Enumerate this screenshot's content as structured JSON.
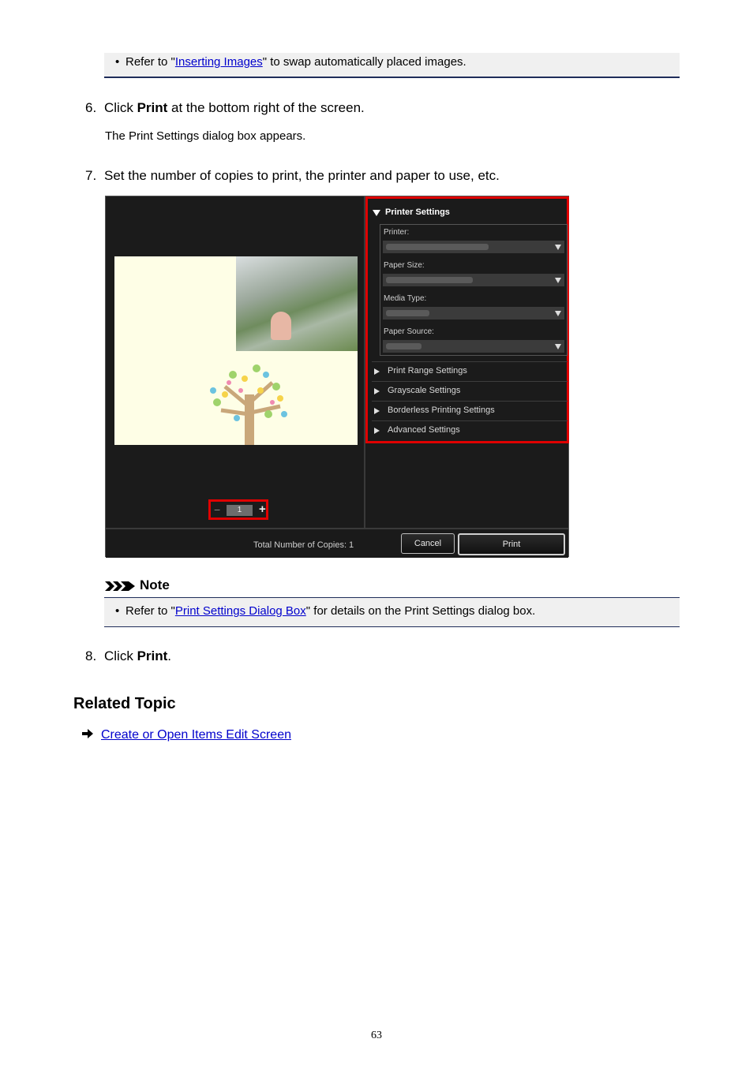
{
  "top_note": {
    "prefix": "Refer to \"",
    "link": "Inserting Images",
    "suffix": "\" to swap automatically placed images."
  },
  "step6": {
    "num": "6.",
    "pre": "Click ",
    "bold": "Print",
    "post": " at the bottom right of the screen.",
    "sub": "The Print Settings dialog box appears."
  },
  "step7": {
    "num": "7.",
    "text": "Set the number of copies to print, the printer and paper to use, etc."
  },
  "dialog": {
    "section_title": "Printer Settings",
    "fields": [
      "Printer:",
      "Paper Size:",
      "Media Type:",
      "Paper Source:"
    ],
    "rows": [
      "Print Range Settings",
      "Grayscale Settings",
      "Borderless Printing Settings",
      "Advanced Settings"
    ],
    "copies_value": "1",
    "total_copies": "Total Number of Copies:  1",
    "cancel": "Cancel",
    "print": "Print"
  },
  "note": {
    "title": "Note",
    "prefix": "Refer to \"",
    "link": "Print Settings Dialog Box",
    "suffix": "\" for details on the Print Settings dialog box."
  },
  "step8": {
    "num": "8.",
    "pre": "Click ",
    "bold": "Print",
    "post": "."
  },
  "related": {
    "heading": "Related Topic",
    "link": "Create or Open Items Edit Screen"
  },
  "page_number": "63"
}
